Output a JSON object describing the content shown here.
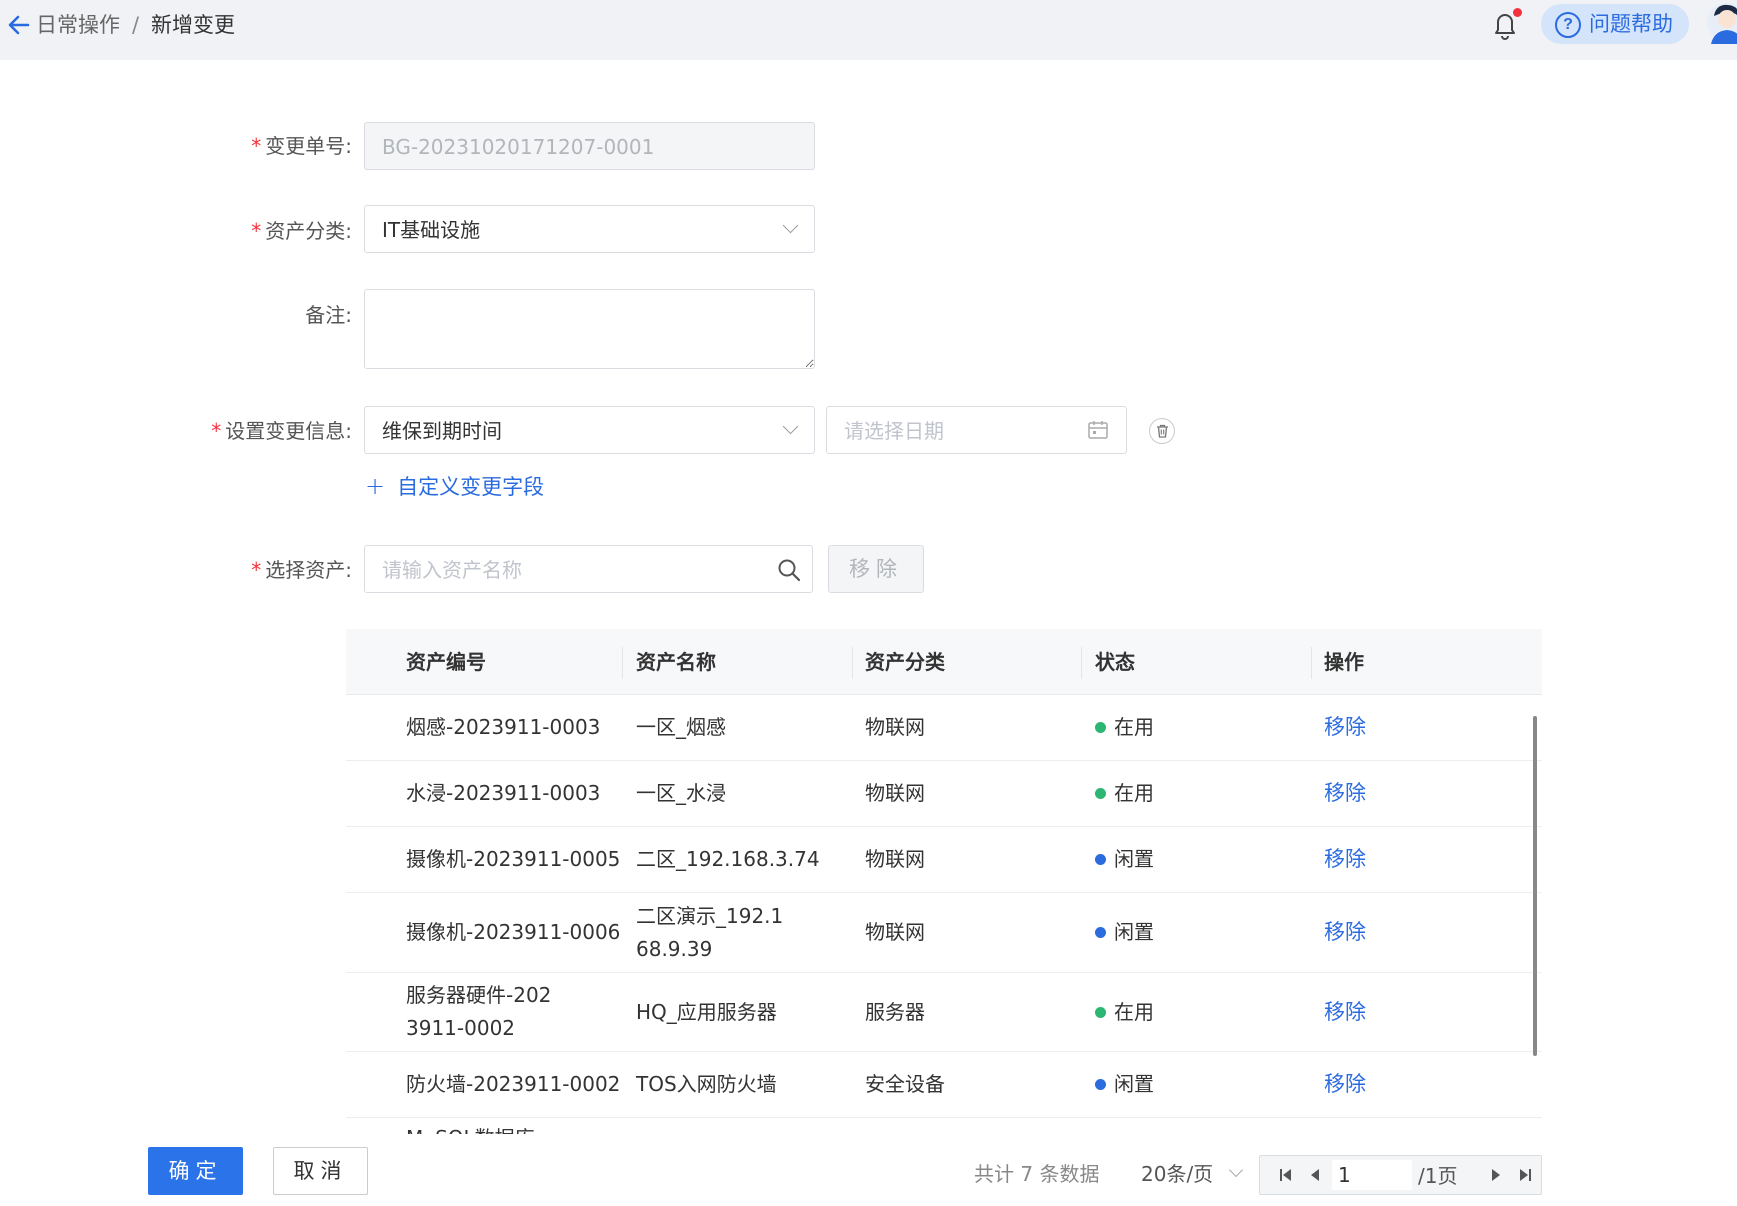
{
  "header": {
    "breadcrumb": [
      "日常操作",
      "新增变更"
    ],
    "breadcrumb_sep": "/",
    "help_label": "问题帮助",
    "help_glyph": "?",
    "icons": [
      "back-arrow-icon",
      "bell-icon",
      "help-circle-icon",
      "user-avatar"
    ],
    "accent_color": "#2b6be0",
    "notification_dot_color": "#f5313d"
  },
  "form": {
    "change_no": {
      "label": "变更单号",
      "value": "BG-20231020171207-0001"
    },
    "asset_category": {
      "label": "资产分类",
      "value": "IT基础设施"
    },
    "remark": {
      "label": "备注",
      "value": ""
    },
    "change_info": {
      "label": "设置变更信息",
      "field_value": "维保到期时间",
      "date_placeholder": "请选择日期"
    },
    "add_custom_field": {
      "plus": "+",
      "label": "自定义变更字段"
    },
    "select_asset": {
      "label": "选择资产",
      "placeholder": "请输入资产名称",
      "remove_label": "移除"
    },
    "label_suffix": ":",
    "required_mark": "*"
  },
  "table": {
    "headers": [
      "资产编号",
      "资产名称",
      "资产分类",
      "状态",
      "操作"
    ],
    "rows": [
      {
        "code": "烟感-2023911-0003",
        "name": "一区_烟感",
        "category": "物联网",
        "status": "在用",
        "status_color": "#2bb673",
        "action": "移除"
      },
      {
        "code": "水浸-2023911-0003",
        "name": "一区_水浸",
        "category": "物联网",
        "status": "在用",
        "status_color": "#2bb673",
        "action": "移除"
      },
      {
        "code": "摄像机-2023911-0005",
        "name": "二区_192.168.3.74",
        "category": "物联网",
        "status": "闲置",
        "status_color": "#2b6be0",
        "action": "移除"
      },
      {
        "code": "摄像机-2023911-0006",
        "name": "二区演示_192.168.9.39",
        "category": "物联网",
        "status": "闲置",
        "status_color": "#2b6be0",
        "action": "移除"
      },
      {
        "code": "服务器硬件-2023911-0002",
        "name": "HQ_应用服务器",
        "category": "服务器",
        "status": "在用",
        "status_color": "#2bb673",
        "action": "移除"
      },
      {
        "code": "防火墙-2023911-0002",
        "name": "TOS入网防火墙",
        "category": "安全设备",
        "status": "闲置",
        "status_color": "#2b6be0",
        "action": "移除"
      },
      {
        "code": "MySQL数据库",
        "name": "",
        "category": "",
        "status": "",
        "status_color": "#2b6be0",
        "action": ""
      }
    ]
  },
  "footer": {
    "confirm_label": "确定",
    "cancel_label": "取消",
    "pagination": {
      "total_text": "共计 7 条数据",
      "page_size": "20条/页",
      "current_page": "1",
      "pages_text": "/1页"
    },
    "primary_color": "#2b73e8"
  }
}
